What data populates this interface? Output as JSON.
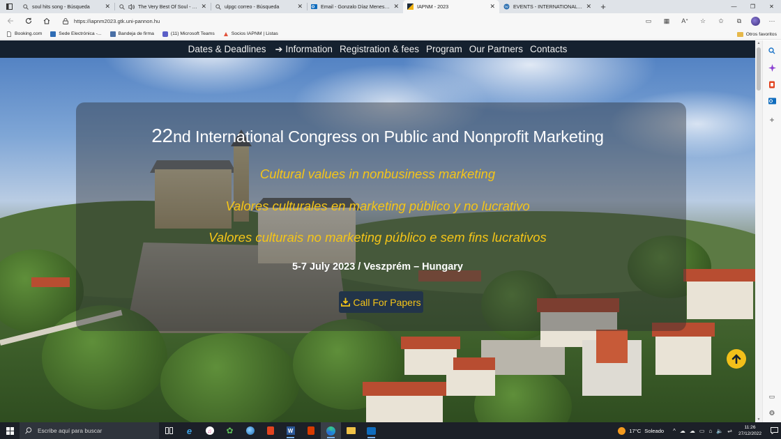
{
  "browser": {
    "tabs": [
      {
        "title": "soul hits song - Búsqueda",
        "icon": "search-icon",
        "active": false
      },
      {
        "title": "The Very Best Of Soul - Gre",
        "icon": "search-icon",
        "active": false,
        "audio": true
      },
      {
        "title": "ulpgc correo - Búsqueda",
        "icon": "search-icon",
        "active": false
      },
      {
        "title": "Email - Gonzalo Díaz Meneses -",
        "icon": "outlook-icon",
        "active": false
      },
      {
        "title": "IAPNM - 2023",
        "icon": "iapnm-favicon",
        "active": true
      },
      {
        "title": "EVENTS - INTERNATIONAL ASSO",
        "icon": "wordpress-icon",
        "active": false
      }
    ],
    "url": "https://iapnm2023.gtk.uni-pannon.hu",
    "bookmarks": [
      {
        "label": "Booking.com",
        "icon": "page-icon"
      },
      {
        "label": "Sede Electrónica -...",
        "icon": "sede-icon"
      },
      {
        "label": "Bandeja de firma",
        "icon": "signature-icon"
      },
      {
        "label": "(11) Microsoft Teams",
        "icon": "teams-icon"
      },
      {
        "label": "Socios IAPNM | Listas",
        "icon": "socios-icon"
      }
    ],
    "other_favorites": "Otros favoritos"
  },
  "site": {
    "nav": [
      "Dates & Deadlines",
      "Information",
      "Registration & fees",
      "Program",
      "Our Partners",
      "Contacts"
    ],
    "title_number": "22",
    "title_suffix": "nd International Congress on Public and Nonprofit Marketing",
    "taglines": [
      "Cultural values in nonbusiness marketing",
      "Valores culturales en marketing público y no lucrativo",
      "Valores culturais no marketing público e sem fins lucrativos"
    ],
    "dates": "5-7 July 2023 / Veszprém – Hungary",
    "cta": "Call For Papers",
    "accent": "#f5c518",
    "nav_bg": "#15212f"
  },
  "taskbar": {
    "search_placeholder": "Escribe aquí para buscar",
    "weather_temp": "17°C",
    "weather_text": "Soleado",
    "time": "11:26",
    "date": "27/12/2022"
  }
}
